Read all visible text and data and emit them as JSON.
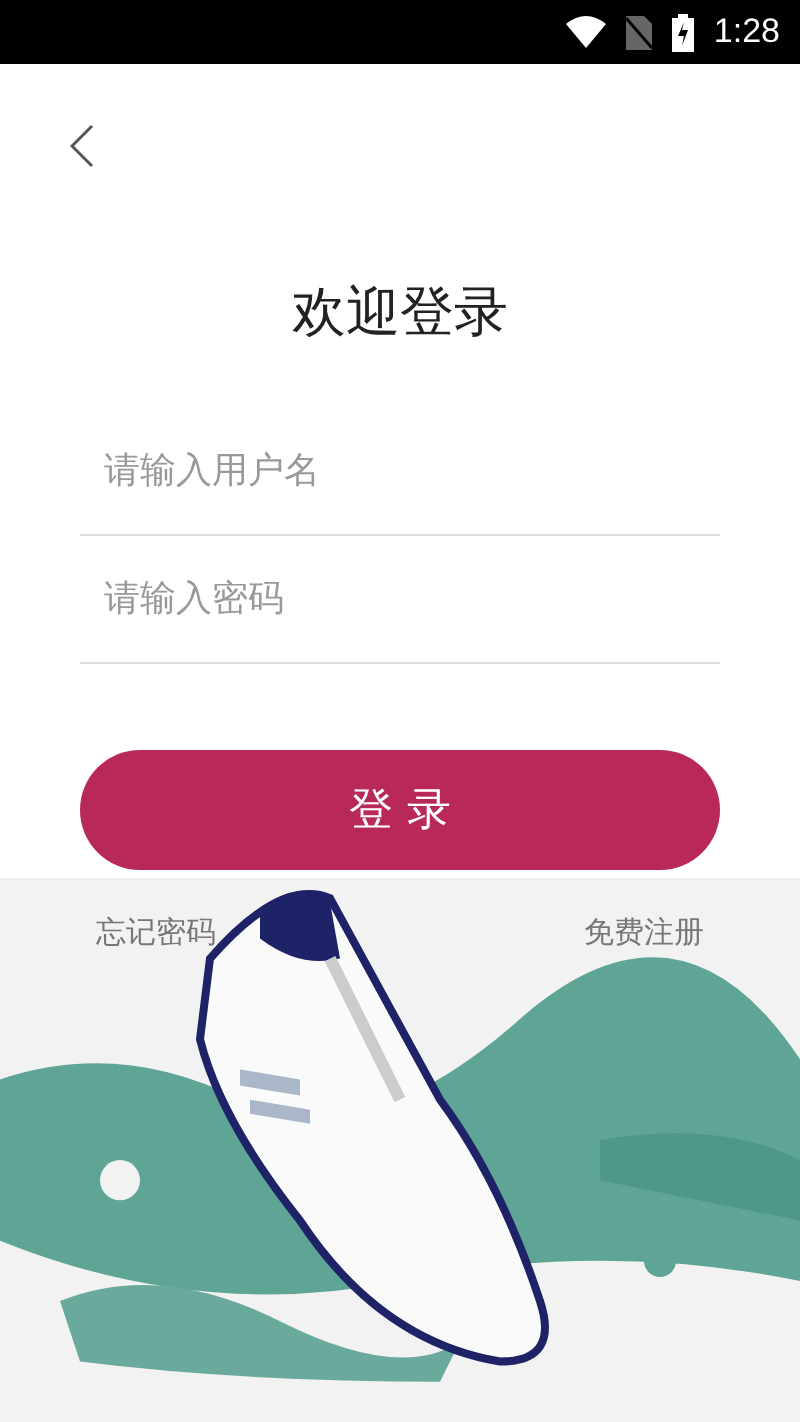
{
  "status_bar": {
    "time": "1:28"
  },
  "title": "欢迎登录",
  "fields": [
    {
      "placeholder": "请输入用户名"
    },
    {
      "placeholder": "请输入密码"
    }
  ],
  "login_button": "登 录",
  "links": {
    "forgot": "忘记密码",
    "register": "免费注册"
  }
}
